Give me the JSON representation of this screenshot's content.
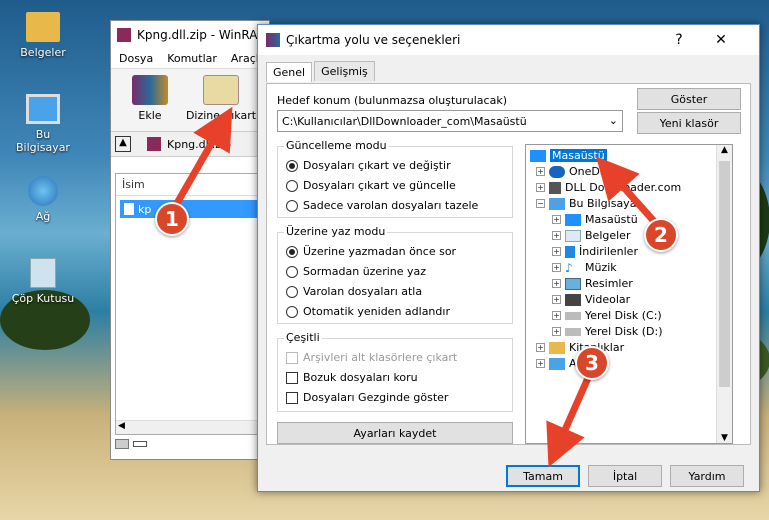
{
  "desktop": {
    "icons": [
      {
        "label": "Belgeler"
      },
      {
        "label": "Bu Bilgisayar"
      },
      {
        "label": "Ağ"
      },
      {
        "label": "Çöp Kutusu"
      }
    ]
  },
  "winrar": {
    "title": "Kpng.dll.zip - WinRAR",
    "menu": [
      "Dosya",
      "Komutlar",
      "Araçlar"
    ],
    "toolbar": [
      {
        "label": "Ekle"
      },
      {
        "label": "Dizine Çıkart"
      }
    ],
    "path": "Kpng.dll.zip",
    "column": "İsim",
    "file": "kp"
  },
  "dialog": {
    "title": "Çıkartma yolu ve seçenekleri",
    "help": "?",
    "close": "✕",
    "tabs": [
      "Genel",
      "Gelişmiş"
    ],
    "dest_label": "Hedef konum (bulunmazsa oluşturulacak)",
    "dest_value": "C:\\Kullanıcılar\\DllDownloader_com\\Masaüstü",
    "show_button": "Göster",
    "newfolder_button": "Yeni klasör",
    "update_group": {
      "title": "Güncelleme modu",
      "options": [
        "Dosyaları çıkart ve değiştir",
        "Dosyaları çıkart ve güncelle",
        "Sadece varolan dosyaları tazele"
      ],
      "selected": 0
    },
    "overwrite_group": {
      "title": "Üzerine yaz modu",
      "options": [
        "Üzerine yazmadan önce sor",
        "Sormadan üzerine yaz",
        "Varolan dosyaları atla",
        "Otomatik yeniden adlandır"
      ],
      "selected": 0
    },
    "misc_group": {
      "title": "Çeşitli",
      "options": [
        "Arşivleri alt klasörlere çıkart",
        "Bozuk dosyaları koru",
        "Dosyaları Gezginde göster"
      ]
    },
    "save_button": "Ayarları kaydet",
    "tree": [
      "Masaüstü",
      "OneDrive",
      "DLL Downloader.com",
      "Bu Bilgisayar",
      "Masaüstü",
      "Belgeler",
      "İndirilenler",
      "Müzik",
      "Resimler",
      "Videolar",
      "Yerel Disk (C:)",
      "Yerel Disk (D:)",
      "Kitaplıklar",
      "Ağ"
    ],
    "ok": "Tamam",
    "cancel": "İptal",
    "helpbtn": "Yardım"
  },
  "callouts": [
    "1",
    "2",
    "3"
  ],
  "colors": {
    "callout": "#d9472b",
    "selection": "#0078d7"
  }
}
